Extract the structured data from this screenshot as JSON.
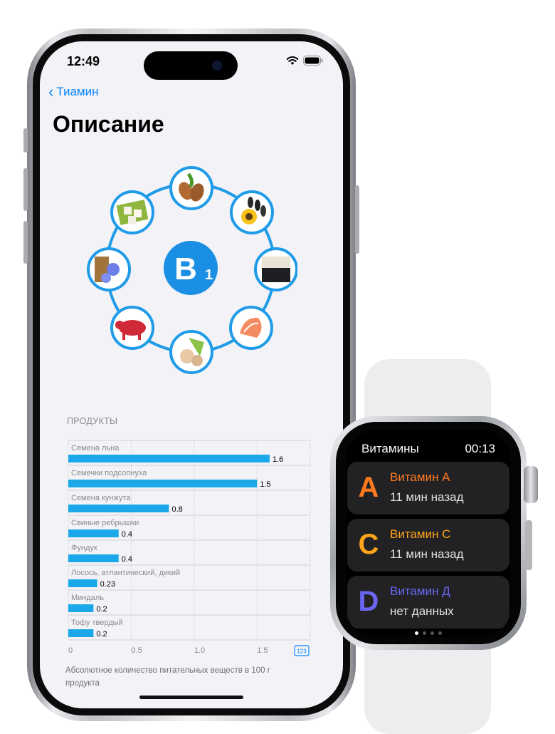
{
  "phone": {
    "status_time": "12:49",
    "back_label": "Тиамин",
    "title": "Описание",
    "center_label": "B",
    "center_sub": "1",
    "food_icons": [
      "almonds-icon",
      "sunflower-seeds-icon",
      "rice-icon",
      "salmon-icon",
      "hazelnut-icon",
      "pork-icon",
      "flax-seeds-icon",
      "tofu-icon"
    ],
    "products_header": "ПРОДУКТЫ",
    "footnote": "Абсолютное количество питательных веществ в 100 г продукта",
    "accessibility_badge": "123"
  },
  "chart_data": {
    "type": "bar",
    "orientation": "horizontal",
    "categories": [
      "Семена льна",
      "Семечки подсолнуха",
      "Семена кунжута",
      "Свиные ребрышки",
      "Фундук",
      "Лосось, атлантический, дикий",
      "Миндаль",
      "Тофу твердый"
    ],
    "values": [
      1.6,
      1.5,
      0.8,
      0.4,
      0.4,
      0.23,
      0.2,
      0.2
    ],
    "value_labels": [
      "1.6",
      "1.5",
      "0.8",
      "0.4",
      "0.4",
      "0.23",
      "0.2",
      "0.2"
    ],
    "x_ticks": [
      "0",
      "0.5",
      "1.0",
      "1.5"
    ],
    "xlim": [
      0,
      1.9
    ],
    "grid": true,
    "bar_color": "#1aa8e8"
  },
  "watch": {
    "title": "Витамины",
    "time": "00:13",
    "cards": [
      {
        "letter": "A",
        "name": "Витамин А",
        "sub": "11 мин назад",
        "color": "#ff7a1f"
      },
      {
        "letter": "C",
        "name": "Витамин C",
        "sub": "11 мин назад",
        "color": "#ffa31a"
      },
      {
        "letter": "D",
        "name": "Витамин Д",
        "sub": "нет данных",
        "color": "#6b66f2"
      }
    ],
    "page_count": 4,
    "page_active": 0
  },
  "colors": {
    "accent": "#0a84ff",
    "ring": "#1f9be8"
  }
}
